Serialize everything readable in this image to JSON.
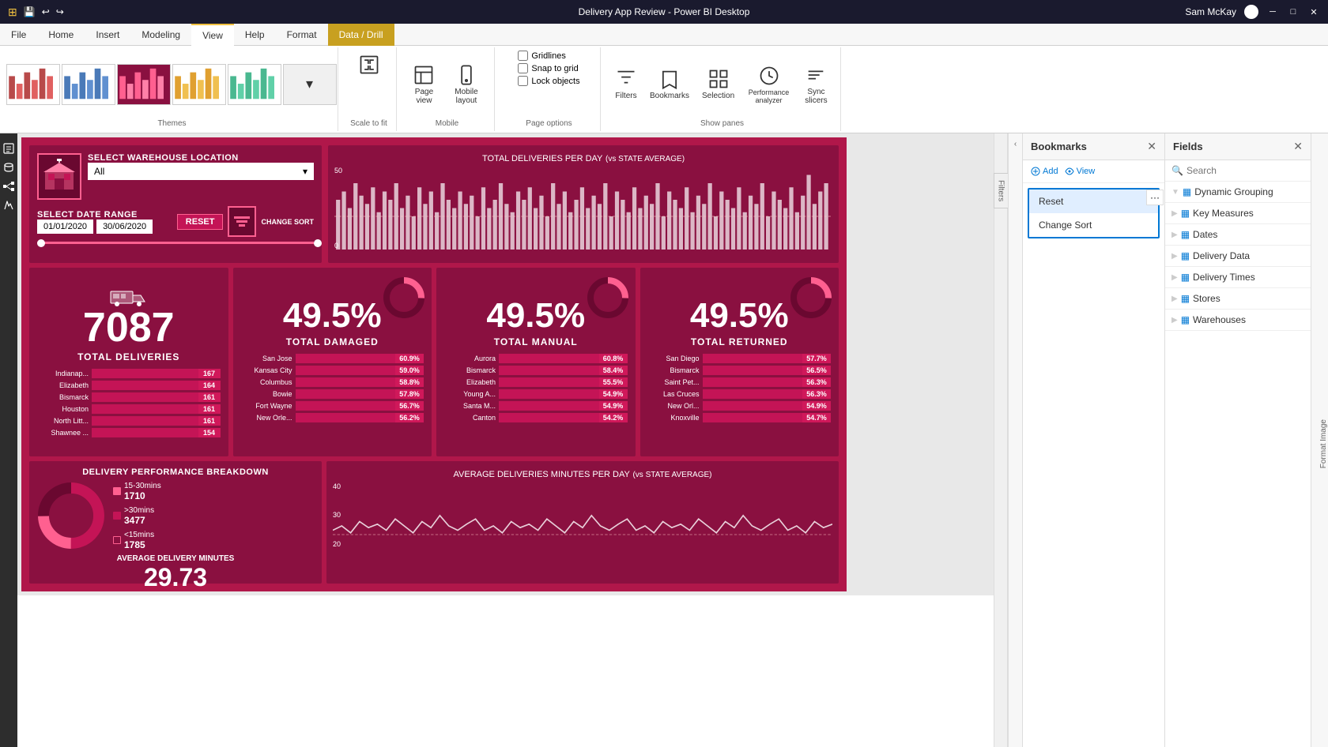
{
  "window": {
    "title": "Delivery App Review - Power BI Desktop",
    "user": "Sam McKay"
  },
  "ribbon": {
    "tabs": [
      "File",
      "Home",
      "Insert",
      "Modeling",
      "View",
      "Help",
      "Format",
      "Data / Drill"
    ],
    "active_tab": "View",
    "format_tab": "Format",
    "data_drill_tab": "Data / Drill",
    "checkboxes": {
      "gridlines": "Gridlines",
      "snap_to_grid": "Snap to grid",
      "lock_objects": "Lock objects"
    },
    "groups": {
      "themes": "Themes",
      "scale_to_fit": "Scale to fit",
      "mobile": "Mobile",
      "page_options": "Page options",
      "show_panes": "Show panes"
    },
    "buttons": {
      "page_view": "Page view",
      "mobile_layout": "Mobile layout",
      "filters": "Filters",
      "bookmarks": "Bookmarks",
      "selection": "Selection",
      "performance": "Performance analyzer",
      "sync_slicers": "Sync slicers"
    }
  },
  "dashboard": {
    "title": "DELIVERY APP REVIEW",
    "warehouse_label": "SELECT WAREHOUSE LOCATION",
    "warehouse_value": "All",
    "date_range_label": "SELECT DATE RANGE",
    "date_from": "01/01/2020",
    "date_to": "30/06/2020",
    "reset_label": "RESET",
    "change_sort_label": "CHANGE SORT",
    "chart_title": "TOTAL DELIVERIES PER DAY",
    "chart_subtitle": "(vs STATE AVERAGE)",
    "chart_y_max": "50",
    "chart_y_min": "0",
    "kpis": [
      {
        "number": "7087",
        "label": "TOTAL DELIVERIES",
        "has_icon": true,
        "bars": [
          {
            "city": "Indianap...",
            "value": 167,
            "max": 200
          },
          {
            "city": "Elizabeth",
            "value": 164,
            "max": 200
          },
          {
            "city": "Bismarck",
            "value": 161,
            "max": 200
          },
          {
            "city": "Houston",
            "value": 161,
            "max": 200
          },
          {
            "city": "North Litt...",
            "value": 161,
            "max": 200
          },
          {
            "city": "Shawnee ...",
            "value": 154,
            "max": 200
          }
        ]
      },
      {
        "number": "49.5%",
        "label": "TOTAL DAMAGED",
        "bars": [
          {
            "city": "San Jose",
            "value": 60.9,
            "max": 100
          },
          {
            "city": "Kansas City",
            "value": 59.0,
            "max": 100
          },
          {
            "city": "Columbus",
            "value": 58.8,
            "max": 100
          },
          {
            "city": "Bowie",
            "value": 57.8,
            "max": 100
          },
          {
            "city": "Fort Wayne",
            "value": 56.7,
            "max": 100
          },
          {
            "city": "New Orle...",
            "value": 56.2,
            "max": 100
          }
        ]
      },
      {
        "number": "49.5%",
        "label": "TOTAL MANUAL",
        "bars": [
          {
            "city": "Aurora",
            "value": 60.8,
            "max": 100
          },
          {
            "city": "Bismarck",
            "value": 58.4,
            "max": 100
          },
          {
            "city": "Elizabeth",
            "value": 55.5,
            "max": 100
          },
          {
            "city": "Young A...",
            "value": 54.9,
            "max": 100
          },
          {
            "city": "Santa M...",
            "value": 54.9,
            "max": 100
          },
          {
            "city": "Canton",
            "value": 54.2,
            "max": 100
          }
        ]
      },
      {
        "number": "49.5%",
        "label": "TOTAL RETURNED",
        "bars": [
          {
            "city": "San Diego",
            "value": 57.7,
            "max": 100
          },
          {
            "city": "Bismarck",
            "value": 56.5,
            "max": 100
          },
          {
            "city": "Saint Pet...",
            "value": 56.3,
            "max": 100
          },
          {
            "city": "Las Cruces",
            "value": 56.3,
            "max": 100
          },
          {
            "city": "New Orl...",
            "value": 54.9,
            "max": 100
          },
          {
            "city": "Knoxville",
            "value": 54.7,
            "max": 100
          }
        ]
      }
    ],
    "perf_title": "DELIVERY PERFORMANCE BREAKDOWN",
    "perf_15_30": "15-30mins",
    "perf_15_30_val": "1710",
    "perf_gt_30": ">30mins",
    "perf_gt_30_val": "3477",
    "perf_lt_15": "<15mins",
    "perf_lt_15_val": "1785",
    "avg_label": "AVERAGE DELIVERY MINUTES",
    "avg_value": "29.73",
    "avg_chart_title": "AVERAGE DELIVERIES MINUTES PER DAY",
    "avg_chart_subtitle": "(vs STATE AVERAGE)",
    "avg_y_40": "40",
    "avg_y_30": "30",
    "avg_y_20": "20"
  },
  "bookmarks": {
    "title": "Bookmarks",
    "add_label": "Add",
    "view_label": "View",
    "items": [
      {
        "label": "Reset",
        "active": true
      },
      {
        "label": "Change Sort",
        "active": false
      }
    ]
  },
  "fields": {
    "title": "Fields",
    "search_placeholder": "Search",
    "groups": [
      {
        "label": "Dynamic Grouping",
        "icon": "table"
      },
      {
        "label": "Key Measures",
        "icon": "table"
      },
      {
        "label": "Dates",
        "icon": "table"
      },
      {
        "label": "Delivery Data",
        "icon": "table"
      },
      {
        "label": "Delivery Times",
        "icon": "table"
      },
      {
        "label": "Stores",
        "icon": "table"
      },
      {
        "label": "Warehouses",
        "icon": "table"
      }
    ]
  }
}
